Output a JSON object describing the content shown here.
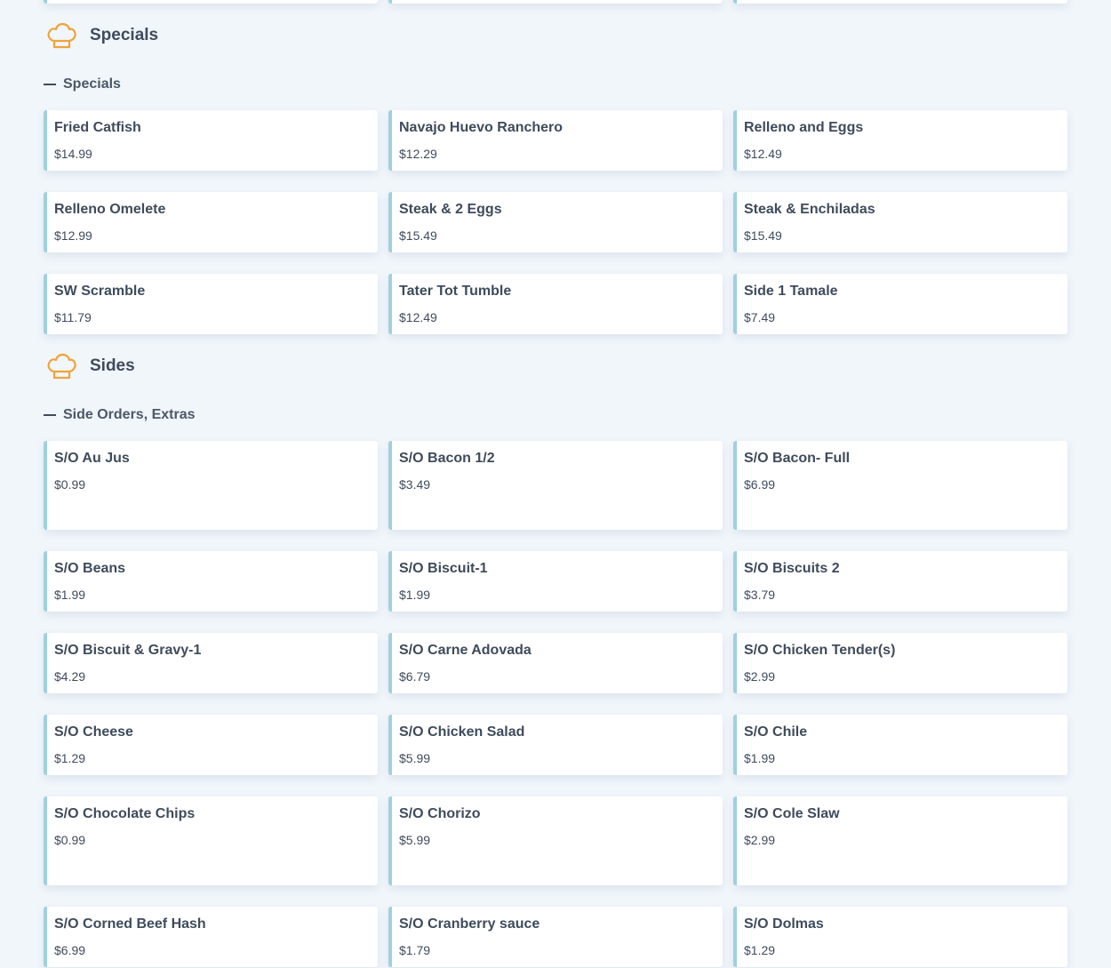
{
  "sections": [
    {
      "title": "Specials",
      "categories": [
        {
          "label": "Specials",
          "items": [
            {
              "name": "Fried Catfish",
              "price": "$14.99"
            },
            {
              "name": "Navajo Huevo Ranchero",
              "price": "$12.29"
            },
            {
              "name": "Relleno and Eggs",
              "price": "$12.49"
            },
            {
              "name": "Relleno Omelete",
              "price": "$12.99"
            },
            {
              "name": "Steak & 2 Eggs",
              "price": "$15.49"
            },
            {
              "name": "Steak & Enchiladas",
              "price": "$15.49"
            },
            {
              "name": "SW Scramble",
              "price": "$11.79"
            },
            {
              "name": "Tater Tot Tumble",
              "price": "$12.49"
            },
            {
              "name": "Side 1 Tamale",
              "price": "$7.49"
            }
          ]
        }
      ]
    },
    {
      "title": "Sides",
      "categories": [
        {
          "label": "Side Orders, Extras",
          "items": [
            {
              "name": "S/O Au Jus",
              "price": "$0.99"
            },
            {
              "name": "S/O Bacon 1/2",
              "price": "$3.49"
            },
            {
              "name": "S/O Bacon- Full",
              "price": "$6.99"
            },
            {
              "name": "S/O Beans",
              "price": "$1.99"
            },
            {
              "name": "S/O Biscuit-1",
              "price": "$1.99"
            },
            {
              "name": "S/O Biscuits 2",
              "price": "$3.79"
            },
            {
              "name": "S/O Biscuit & Gravy-1",
              "price": "$4.29"
            },
            {
              "name": "S/O Carne Adovada",
              "price": "$6.79"
            },
            {
              "name": "S/O Chicken Tender(s)",
              "price": "$2.99"
            },
            {
              "name": "S/O Cheese",
              "price": "$1.29"
            },
            {
              "name": "S/O Chicken Salad",
              "price": "$5.99"
            },
            {
              "name": "S/O Chile",
              "price": "$1.99"
            },
            {
              "name": "S/O Chocolate Chips",
              "price": "$0.99"
            },
            {
              "name": "S/O Chorizo",
              "price": "$5.99"
            },
            {
              "name": "S/O Cole Slaw",
              "price": "$2.99"
            },
            {
              "name": "S/O Corned Beef Hash",
              "price": "$6.99"
            },
            {
              "name": "S/O Cranberry sauce",
              "price": "$1.79"
            },
            {
              "name": "S/O Dolmas",
              "price": "$1.29"
            }
          ]
        }
      ]
    }
  ],
  "icons": {
    "section_icon": "chef-hat-icon",
    "category_icon": "collapse-dash-icon"
  },
  "colors": {
    "accent": "#f0a33a",
    "card_border": "#9fd0e0",
    "background": "#f1f6fb",
    "text": "#3f4b5c"
  }
}
